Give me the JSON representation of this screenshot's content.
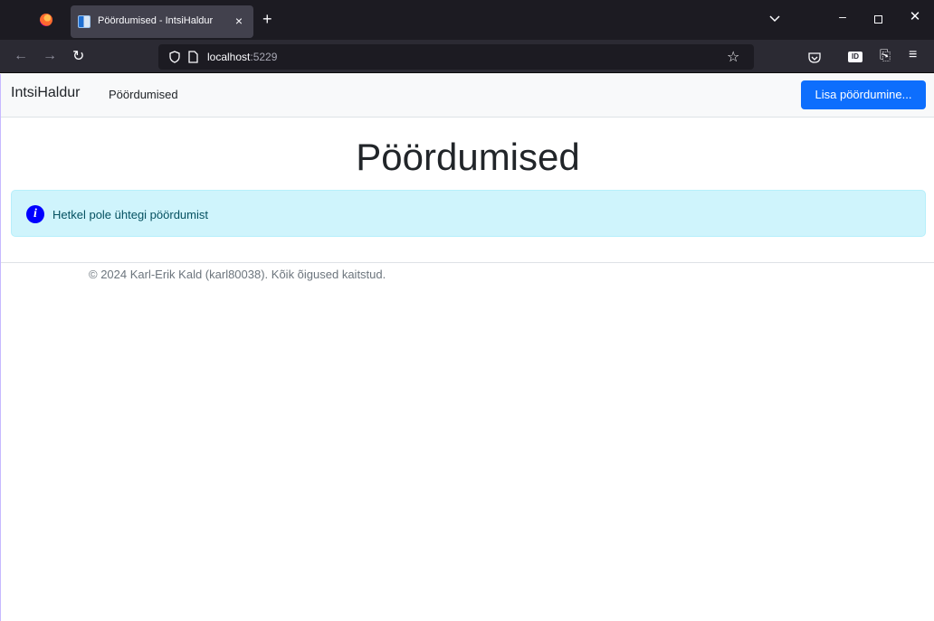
{
  "browser": {
    "tab_title": "Pöördumised - IntsiHaldur",
    "tab_close": "×",
    "new_tab": "+",
    "url_host": "localhost",
    "url_port": ":5229",
    "icons": {
      "firefox": "firefox-logo-icon",
      "favicon": "page-favicon-icon",
      "back": "back-arrow-icon",
      "forward": "forward-arrow-icon",
      "reload": "reload-icon",
      "bookmark": "star-icon",
      "pocket": "pocket-icon",
      "menu": "hamburger-menu-icon"
    }
  },
  "site": {
    "brand": "IntsiHaldur",
    "nav_link": "Pöördumised",
    "add_button": "Lisa pöördumine...",
    "page_title": "Pöördumised",
    "alert": {
      "text": "Hetkel pole ühtegi pöördumist",
      "icon": "info-icon",
      "bg_color": "#cff4fc"
    },
    "footer": "© 2024 Karl-Erik Kald (karl80038). Kõik õigused kaitstud."
  },
  "colors": {
    "primary": "#0d6efd",
    "navbar_bg": "#f8f9fa",
    "chrome_dark": "#1c1b22"
  }
}
